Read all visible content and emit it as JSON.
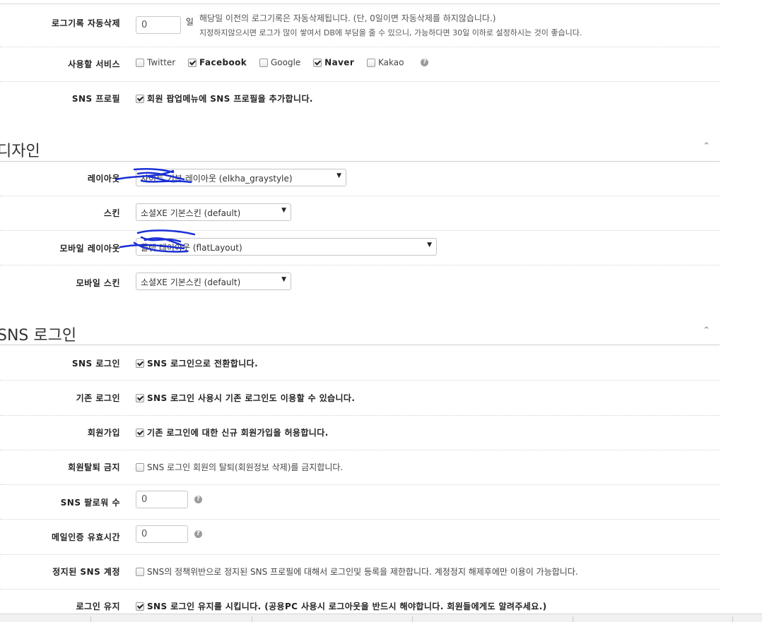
{
  "log_delete": {
    "label": "로그기록 자동삭제",
    "value": "0",
    "unit": "일",
    "help_line1": "해당일 이전의 로그기록은 자동삭제됩니다. (단, 0일이면 자동삭제를 하지않습니다.)",
    "help_line2": "지정하지않으시면 로그가 많이 쌓여서 DB에 부담을 줄 수 있으니, 가능하다면 30일 이하로 설정하시는 것이 좋습니다."
  },
  "services": {
    "label": "사용할 서비스",
    "options": [
      {
        "label": "Twitter",
        "checked": false
      },
      {
        "label": "Facebook",
        "checked": true
      },
      {
        "label": "Google",
        "checked": false
      },
      {
        "label": "Naver",
        "checked": true
      },
      {
        "label": "Kakao",
        "checked": false
      }
    ]
  },
  "sns_profile": {
    "label": "SNS 프로필",
    "text": "회원 팝업메뉴에 SNS 프로필을 추가합니다.",
    "checked": true
  },
  "design": {
    "title": "디자인",
    "layout": {
      "label": "레이아웃",
      "value": "사이트 기본 레이아웃 (elkha_graystyle)"
    },
    "skin": {
      "label": "스킨",
      "value": "소셜XE 기본스킨 (default)"
    },
    "mobile_layout": {
      "label": "모바일 레이아웃",
      "value": "플랫 레이아웃 (flatLayout)"
    },
    "mobile_skin": {
      "label": "모바일 스킨",
      "value": "소셜XE 기본스킨 (default)"
    }
  },
  "sns_login": {
    "title": "SNS 로그인",
    "rows": [
      {
        "label": "SNS 로그인",
        "text": "SNS 로그인으로 전환합니다.",
        "checked": true
      },
      {
        "label": "기존 로그인",
        "text": "SNS 로그인 사용시 기존 로그인도 이용할 수 있습니다.",
        "checked": true
      },
      {
        "label": "회원가입",
        "text": "기존 로그인에 대한 신규 회원가입을 허용합니다.",
        "checked": true
      },
      {
        "label": "회원탈퇴 금지",
        "text": "SNS 로그인 회원의 탈퇴(회원정보 삭제)를 금지합니다.",
        "checked": false
      }
    ],
    "follower": {
      "label": "SNS 팔로워 수",
      "value": "0"
    },
    "mail_auth": {
      "label": "메일인증 유효시간",
      "value": "0"
    },
    "suspended": {
      "label": "정지된 SNS 계정",
      "text": "SNS의 정책위반으로 정지된 SNS 프로필에 대해서 로그인및 등록을 제한합니다. 계정정지 해제후에만 이용이 가능합니다.",
      "checked": false
    },
    "keep_login": {
      "label": "로그인 유지",
      "text": "SNS 로그인 유지를 시킵니다. (공용PC 사용시 로그아웃을 반드시 해야합니다. 회원들에게도 알려주세요.)",
      "checked": true
    }
  },
  "icons": {
    "help": "?",
    "collapse": "^",
    "select_arrow": "▼"
  }
}
